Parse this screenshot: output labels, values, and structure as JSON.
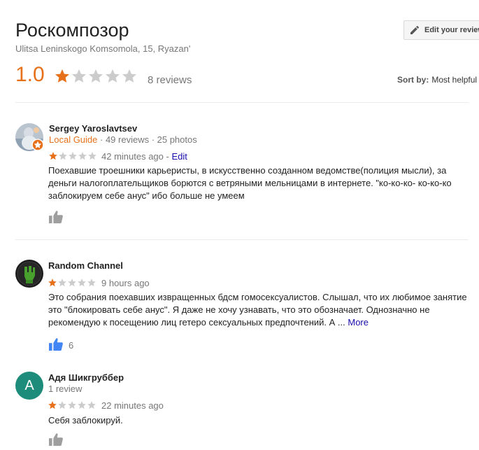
{
  "place": {
    "name": "Роскомпозор",
    "address": "Ulitsa Leninskogo Komsomola, 15, Ryazan'",
    "rating": "1.0",
    "rating_stars": 1,
    "review_count": "8 reviews"
  },
  "edit_button": {
    "label": "Edit your review"
  },
  "sort": {
    "label": "Sort by:",
    "value": "Most helpful"
  },
  "colors": {
    "star_filled": "#e7711b",
    "star_empty": "#cccccc",
    "link": "#1a0dab",
    "thumb_active": "#4285f4",
    "thumb_inactive": "#9e9e9e"
  },
  "reviews": [
    {
      "author": "Sergey Yaroslavtsev",
      "guide": "Local Guide",
      "stats": " · 49 reviews · 25 photos",
      "stars": 1,
      "date": "42 minutes ago",
      "sep": " - ",
      "edit": "Edit",
      "text": "Поехавшие троешники карьеристы, в искусственно созданном ведомстве(полиция мысли), за деньги налогоплательщиков борются с ветряными мельницами в интернете. \"ко-ко-ко- ко-ко-ко заблокируем себе анус\" ибо больше не умеем",
      "avatar": "photo-with-local-guide-badge"
    },
    {
      "author": "Random Channel",
      "stars": 1,
      "date": "9 hours ago",
      "text": "Это собрания поехавших извращенных бдсм гомосексуалистов. Слышал, что их любимое занятие это \"блокировать себе анус\". Я даже не хочу узнавать, что это обозначает. Однозначно не рекомендую к посещению лиц гетеро сексуальных предпочтений. А ...",
      "more": "More",
      "likes": "6",
      "avatar": "green-fist-icon"
    },
    {
      "author": "Адя Шикгруббер",
      "stats": "1 review",
      "stars": 1,
      "date": "22 minutes ago",
      "text": "Себя заблокируй.",
      "avatar_letter": "A"
    }
  ]
}
